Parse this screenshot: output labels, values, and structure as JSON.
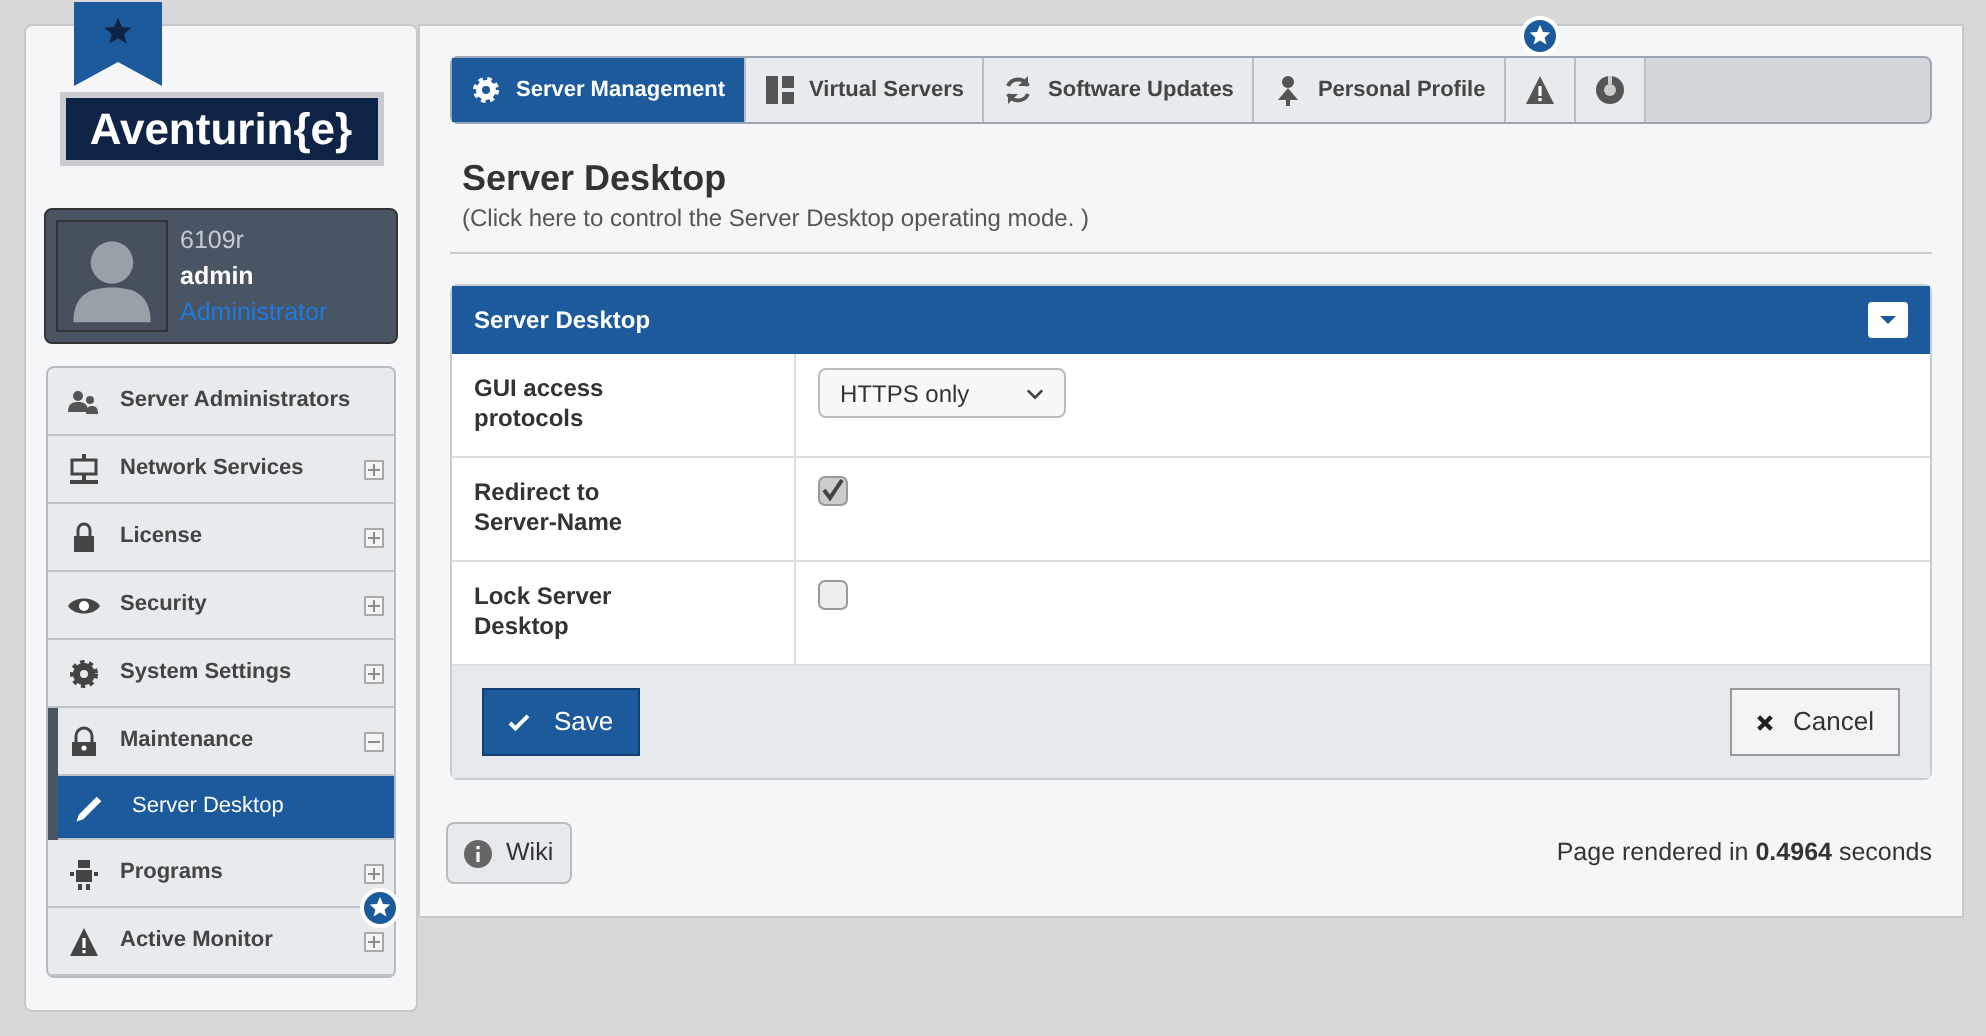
{
  "logo": {
    "text": "Aventurin{e}"
  },
  "user": {
    "host": "6109r",
    "name": "admin",
    "role": "Administrator"
  },
  "sidebar": {
    "items": [
      {
        "label": "Server Administrators",
        "kind": "link",
        "expanded": false,
        "flagged": false
      },
      {
        "label": "Network Services",
        "kind": "group",
        "expanded": false,
        "flagged": false
      },
      {
        "label": "License",
        "kind": "group",
        "expanded": false,
        "flagged": false
      },
      {
        "label": "Security",
        "kind": "group",
        "expanded": false,
        "flagged": false
      },
      {
        "label": "System Settings",
        "kind": "group",
        "expanded": false,
        "flagged": false
      },
      {
        "label": "Maintenance",
        "kind": "group",
        "expanded": true,
        "flagged": false,
        "children": [
          {
            "label": "Server Desktop",
            "selected": true
          }
        ]
      },
      {
        "label": "Programs",
        "kind": "group",
        "expanded": false,
        "flagged": false
      },
      {
        "label": "Active Monitor",
        "kind": "group",
        "expanded": false,
        "flagged": true
      }
    ]
  },
  "tabs": [
    {
      "label": "Server Management",
      "kind": "text",
      "selected": true,
      "flagged": false
    },
    {
      "label": "Virtual Servers",
      "kind": "text",
      "selected": false,
      "flagged": false
    },
    {
      "label": "Software Updates",
      "kind": "text",
      "selected": false,
      "flagged": false
    },
    {
      "label": "Personal Profile",
      "kind": "text",
      "selected": false,
      "flagged": false
    },
    {
      "kind": "icon",
      "selected": false,
      "flagged": true
    },
    {
      "kind": "icon",
      "selected": false,
      "flagged": false
    }
  ],
  "page": {
    "title": "Server Desktop",
    "subtitle": "(Click here to control the Server Desktop operating mode. )"
  },
  "form": {
    "title": "Server Desktop",
    "rows": [
      {
        "label": "GUI access protocols",
        "kind": "select",
        "value": "HTTPS only"
      },
      {
        "label": "Redirect to Server-Name",
        "kind": "checkbox",
        "checked": true
      },
      {
        "label": "Lock Server Desktop",
        "kind": "checkbox",
        "checked": false
      }
    ],
    "save": "Save",
    "cancel": "Cancel"
  },
  "wiki": "Wiki",
  "footer": "Page rendered in **0.4964** seconds"
}
